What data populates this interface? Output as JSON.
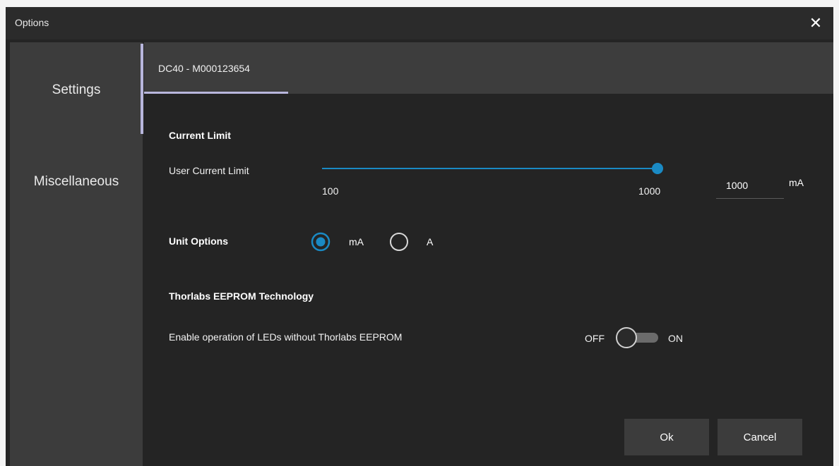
{
  "window": {
    "title": "Options"
  },
  "sidebar": {
    "items": [
      {
        "label": "Settings"
      },
      {
        "label": "Miscellaneous"
      }
    ]
  },
  "tabs": [
    {
      "label": "DC40 - M000123654"
    }
  ],
  "current_limit": {
    "heading": "Current Limit",
    "label": "User Current Limit",
    "slider_min": "100",
    "slider_max": "1000",
    "value": "1000",
    "unit": "mA"
  },
  "unit_options": {
    "label": "Unit Options",
    "options": [
      {
        "label": "mA",
        "selected": true
      },
      {
        "label": "A",
        "selected": false
      }
    ]
  },
  "eeprom": {
    "heading": "Thorlabs EEPROM Technology",
    "description": "Enable operation of LEDs without Thorlabs EEPROM",
    "off_label": "OFF",
    "on_label": "ON",
    "state": "off"
  },
  "buttons": {
    "ok": "Ok",
    "cancel": "Cancel"
  },
  "icons": {
    "close": "close-icon"
  },
  "colors": {
    "accent": "#1a8ac4",
    "indicator": "#b8b6dc",
    "background": "#242424",
    "sidebar": "#3c3c3c"
  }
}
